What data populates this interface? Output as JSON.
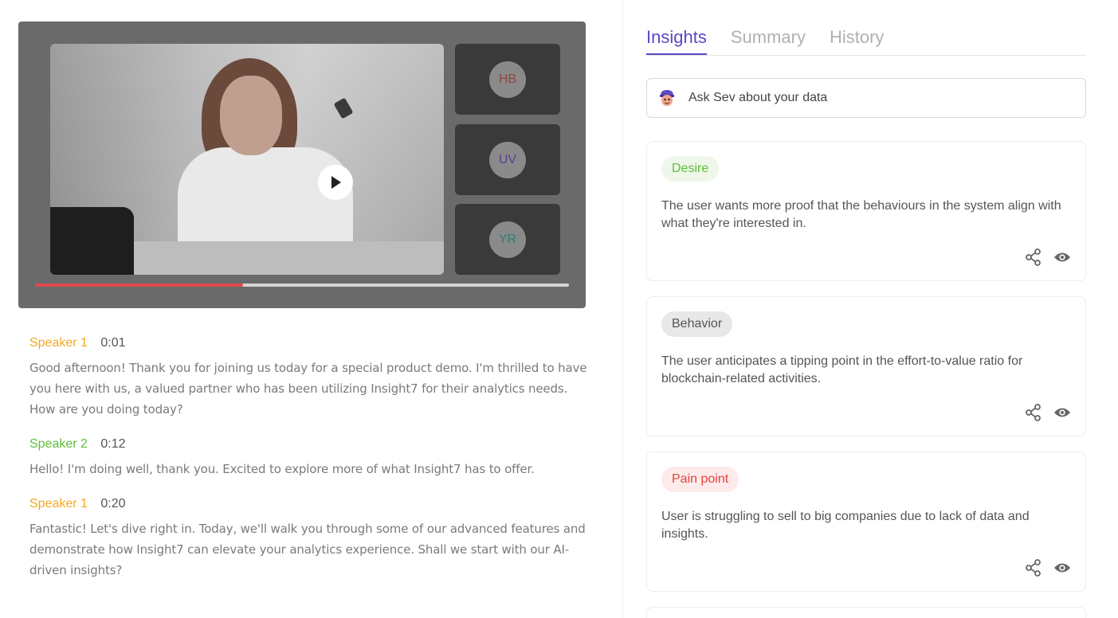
{
  "player": {
    "progress_fraction": 0.39,
    "participants": [
      {
        "initials": "HB",
        "color": "#8a4a3a"
      },
      {
        "initials": "UV",
        "color": "#5b3f8a"
      },
      {
        "initials": "YR",
        "color": "#2f7f78"
      }
    ]
  },
  "transcript": [
    {
      "speaker": "Speaker 1",
      "time": "0:01",
      "color": "#f2a926",
      "text": "Good afternoon! Thank you for joining us today for a special product demo. I'm thrilled to have you here with us, a valued partner who has been utilizing Insight7 for their analytics needs. How are you doing today?"
    },
    {
      "speaker": "Speaker 2",
      "time": "0:12",
      "color": "#5fbf3b",
      "text": "Hello! I'm doing well, thank you. Excited to explore more of what Insight7 has to offer."
    },
    {
      "speaker": "Speaker 1",
      "time": "0:20",
      "color": "#f2a926",
      "text": "Fantastic! Let's dive right in. Today, we'll walk you through some of our advanced features and demonstrate how Insight7 can elevate your analytics experience. Shall we start with our AI-driven insights?"
    }
  ],
  "tabs": [
    {
      "label": "Insights",
      "active": true
    },
    {
      "label": "Summary",
      "active": false
    },
    {
      "label": "History",
      "active": false
    }
  ],
  "ask": {
    "label": "Ask Sev about your data"
  },
  "insights": [
    {
      "tag": "Desire",
      "tag_color": "#5fbf3b",
      "tag_bg": "#eef7ea",
      "text": "The user wants more proof that the behaviours in the system align with what they're interested in."
    },
    {
      "tag": "Behavior",
      "tag_color": "#555555",
      "tag_bg": "#e8e8e8",
      "text": "The user anticipates a tipping point in the effort-to-value ratio for blockchain-related activities."
    },
    {
      "tag": "Pain point",
      "tag_color": "#e0443c",
      "tag_bg": "#fcebea",
      "text": "User is struggling to sell to big companies due to lack of data and insights."
    }
  ]
}
